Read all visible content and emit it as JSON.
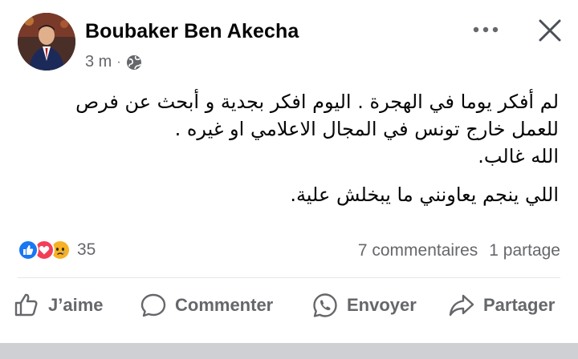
{
  "post": {
    "author": "Boubaker Ben Akecha",
    "time": "3 m",
    "separator": "·",
    "icons": {
      "audience": "globe-icon",
      "more": "more-options-icon",
      "close": "close-icon"
    },
    "text_lines": [
      "لم أفكر يوما في الهجرة . اليوم افكر بجدية و أبحث عن فرص",
      "للعمل خارج تونس في المجال الاعلامي او غيره .",
      "الله غالب.",
      "اللي ينجم يعاونني ما يبخلش علية."
    ],
    "reactions": {
      "types": [
        "like-icon",
        "love-icon",
        "sad-icon"
      ],
      "count": "35"
    },
    "comments": "7 commentaires",
    "shares": "1 partage"
  },
  "actions": {
    "like": "J’aime",
    "comment": "Commenter",
    "send": "Envoyer",
    "share": "Partager"
  },
  "colors": {
    "like_blue": "#1877f2",
    "love_red": "#f33e58",
    "sad_yellow": "#f7b125",
    "secondary_text": "#65676b"
  }
}
